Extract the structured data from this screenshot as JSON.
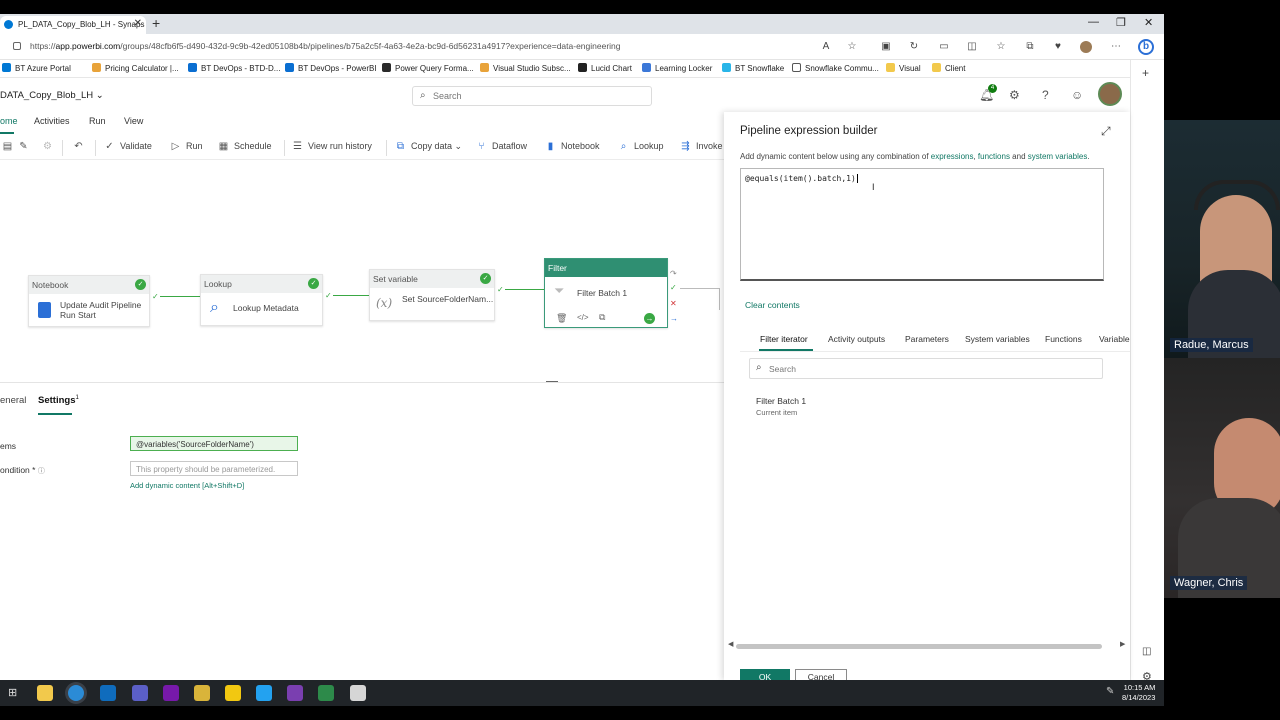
{
  "browser": {
    "tab_title": "PL_DATA_Copy_Blob_LH - Synaps",
    "url_prefix": "https://",
    "url_host": "app.powerbi.com",
    "url_path": "/groups/48cfb6f5-d490-432d-9c9b-42ed05108b4b/pipelines/b75a2c5f-4a63-4e2a-bc9d-6d56231a4917?experience=data-engineering"
  },
  "bookmarks": [
    {
      "label": "BT Azure Portal",
      "color": "#0078d4"
    },
    {
      "label": "Pricing Calculator |...",
      "color": "#e8a33a"
    },
    {
      "label": "BT DevOps - BTD-D...",
      "color": "#0a6ed1"
    },
    {
      "label": "BT DevOps - PowerBI",
      "color": "#0a6ed1"
    },
    {
      "label": "Power Query Forma...",
      "color": "#2a2a2a"
    },
    {
      "label": "Visual Studio Subsc...",
      "color": "#e8a33a"
    },
    {
      "label": "Lucid Chart",
      "color": "#222222"
    },
    {
      "label": "Learning Locker",
      "color": "#3c78d8"
    },
    {
      "label": "BT Snowflake",
      "color": "#29b5e8"
    },
    {
      "label": "Snowflake Commu...",
      "color": "#555555"
    },
    {
      "label": "Visual",
      "color": "#f2c94c"
    },
    {
      "label": "Client",
      "color": "#f2c94c"
    }
  ],
  "app": {
    "pipeline_name": "DATA_Copy_Blob_LH",
    "search_placeholder": "Search",
    "notification_count": "4"
  },
  "menus": [
    "ome",
    "Activities",
    "Run",
    "View"
  ],
  "toolbar": {
    "validate": "Validate",
    "run": "Run",
    "schedule": "Schedule",
    "view_run_history": "View run history",
    "copy_data": "Copy data",
    "dataflow": "Dataflow",
    "notebook": "Notebook",
    "lookup": "Lookup",
    "invoke": "Invoke"
  },
  "activities": [
    {
      "type": "Notebook",
      "name": "Update Audit Pipeline Run Start"
    },
    {
      "type": "Lookup",
      "name": "Lookup Metadata"
    },
    {
      "type": "Set variable",
      "name": "Set SourceFolderNam..."
    },
    {
      "type": "Filter",
      "name": "Filter Batch 1"
    }
  ],
  "settings": {
    "tab_general": "eneral",
    "tab_settings": "Settings",
    "tab_settings_sup": "1",
    "items_label": "ems",
    "items_value": "@variables('SourceFolderName')",
    "condition_label": "ondition *",
    "condition_placeholder": "This property should be parameterized.",
    "add_dynamic": "Add dynamic content [Alt+Shift+D]"
  },
  "panel": {
    "title": "Pipeline expression builder",
    "desc_prefix": "Add dynamic content below using any combination of ",
    "desc_expressions": "expressions",
    "desc_comma": ", ",
    "desc_functions": "functions",
    "desc_and": " and ",
    "desc_sysvars": "system variables",
    "desc_end": ".",
    "expression": "@equals(item().batch,1)",
    "clear_contents": "Clear contents",
    "tabs": [
      "Filter iterator",
      "Activity outputs",
      "Parameters",
      "System variables",
      "Functions",
      "Variable"
    ],
    "search_placeholder": "Search",
    "item_title": "Filter Batch 1",
    "item_subtitle": "Current item",
    "ok": "OK",
    "cancel": "Cancel"
  },
  "taskbar": {
    "time": "10:15 AM",
    "date": "8/14/2023"
  },
  "participants": [
    "Radue, Marcus",
    "Wagner, Chris"
  ],
  "colors": {
    "accent": "#117865",
    "success": "#3aa844"
  }
}
